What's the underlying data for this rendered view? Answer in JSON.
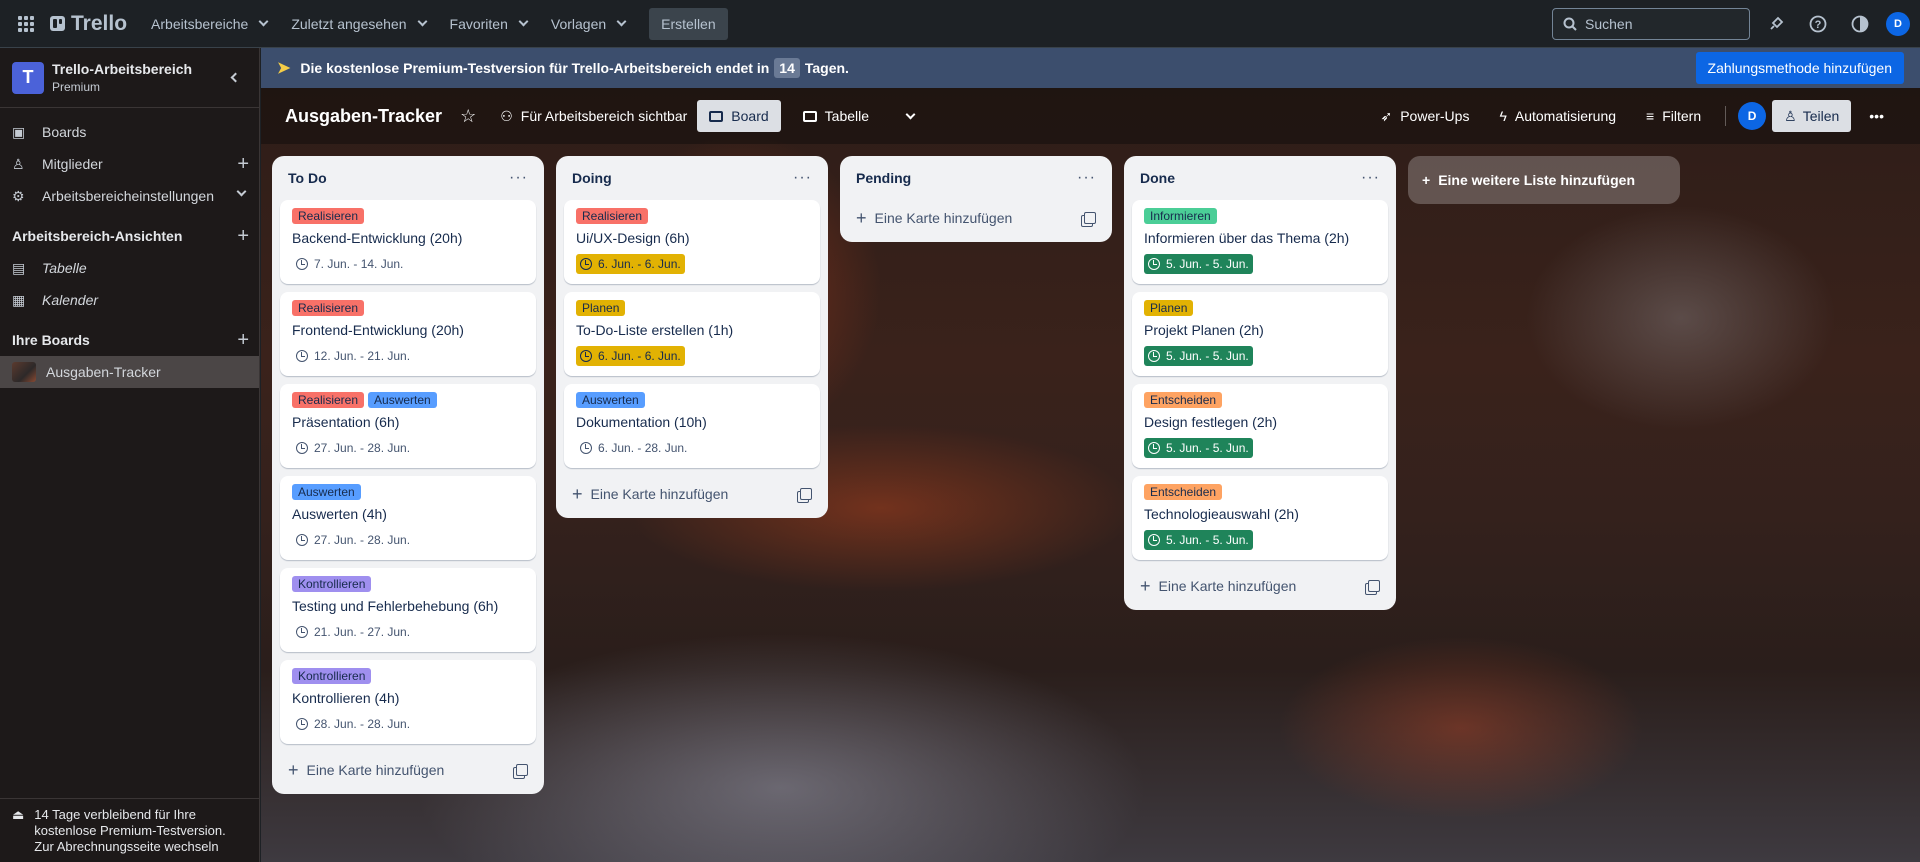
{
  "topbar": {
    "logo": "Trello",
    "nav": [
      "Arbeitsbereiche",
      "Zuletzt angesehen",
      "Favoriten",
      "Vorlagen"
    ],
    "create": "Erstellen",
    "search_placeholder": "Suchen",
    "avatar": "D"
  },
  "sidebar": {
    "workspace_initial": "T",
    "workspace_name": "Trello-Arbeitsbereich",
    "workspace_plan": "Premium",
    "items": [
      "Boards",
      "Mitglieder",
      "Arbeitsbereicheinstellungen"
    ],
    "views_title": "Arbeitsbereich-Ansichten",
    "views": [
      "Tabelle",
      "Kalender"
    ],
    "boards_title": "Ihre Boards",
    "boards": [
      "Ausgaben-Tracker"
    ],
    "trial_note": "14 Tage verbleibend für Ihre kostenlose Premium-Testversion. Zur Abrechnungsseite wechseln"
  },
  "banner": {
    "text_before": "Die kostenlose Premium-Testversion für Trello-Arbeitsbereich endet in",
    "days": "14",
    "text_after": "Tagen.",
    "button": "Zahlungsmethode hinzufügen"
  },
  "board": {
    "title": "Ausgaben-Tracker",
    "visibility": "Für Arbeitsbereich sichtbar",
    "views": [
      "Board",
      "Tabelle"
    ],
    "actions": [
      "Power-Ups",
      "Automatisierung",
      "Filtern"
    ],
    "avatar": "D",
    "share": "Teilen",
    "add_card": "Eine Karte hinzufügen",
    "add_list": "Eine weitere Liste hinzufügen"
  },
  "colors": {
    "Realisieren": "#f87168",
    "Auswerten": "#579dff",
    "Kontrollieren": "#9f8fef",
    "Planen": "#e2b203",
    "Informieren": "#4bce97",
    "Entscheiden": "#fea362"
  },
  "lists": [
    {
      "title": "To Do",
      "cards": [
        {
          "labels": [
            "Realisieren"
          ],
          "title": "Backend-Entwicklung (20h)",
          "date": "7. Jun. - 14. Jun.",
          "date_style": "plain"
        },
        {
          "labels": [
            "Realisieren"
          ],
          "title": "Frontend-Entwicklung (20h)",
          "date": "12. Jun. - 21. Jun.",
          "date_style": "plain"
        },
        {
          "labels": [
            "Realisieren",
            "Auswerten"
          ],
          "title": "Präsentation (6h)",
          "date": "27. Jun. - 28. Jun.",
          "date_style": "plain"
        },
        {
          "labels": [
            "Auswerten"
          ],
          "title": "Auswerten (4h)",
          "date": "27. Jun. - 28. Jun.",
          "date_style": "plain"
        },
        {
          "labels": [
            "Kontrollieren"
          ],
          "title": "Testing und Fehlerbehebung (6h)",
          "date": "21. Jun. - 27. Jun.",
          "date_style": "plain"
        },
        {
          "labels": [
            "Kontrollieren"
          ],
          "title": "Kontrollieren (4h)",
          "date": "28. Jun. - 28. Jun.",
          "date_style": "plain"
        }
      ]
    },
    {
      "title": "Doing",
      "cards": [
        {
          "labels": [
            "Realisieren"
          ],
          "title": "Ui/UX-Design (6h)",
          "date": "6. Jun. - 6. Jun.",
          "date_style": "yellow"
        },
        {
          "labels": [
            "Planen"
          ],
          "title": "To-Do-Liste erstellen (1h)",
          "date": "6. Jun. - 6. Jun.",
          "date_style": "yellow"
        },
        {
          "labels": [
            "Auswerten"
          ],
          "title": "Dokumentation (10h)",
          "date": "6. Jun. - 28. Jun.",
          "date_style": "plain"
        }
      ]
    },
    {
      "title": "Pending",
      "cards": []
    },
    {
      "title": "Done",
      "cards": [
        {
          "labels": [
            "Informieren"
          ],
          "title": "Informieren über das Thema (2h)",
          "date": "5. Jun. - 5. Jun.",
          "date_style": "green"
        },
        {
          "labels": [
            "Planen"
          ],
          "title": "Projekt Planen (2h)",
          "date": "5. Jun. - 5. Jun.",
          "date_style": "green"
        },
        {
          "labels": [
            "Entscheiden"
          ],
          "title": "Design festlegen (2h)",
          "date": "5. Jun. - 5. Jun.",
          "date_style": "green"
        },
        {
          "labels": [
            "Entscheiden"
          ],
          "title": "Technologieauswahl (2h)",
          "date": "5. Jun. - 5. Jun.",
          "date_style": "green"
        }
      ]
    }
  ]
}
